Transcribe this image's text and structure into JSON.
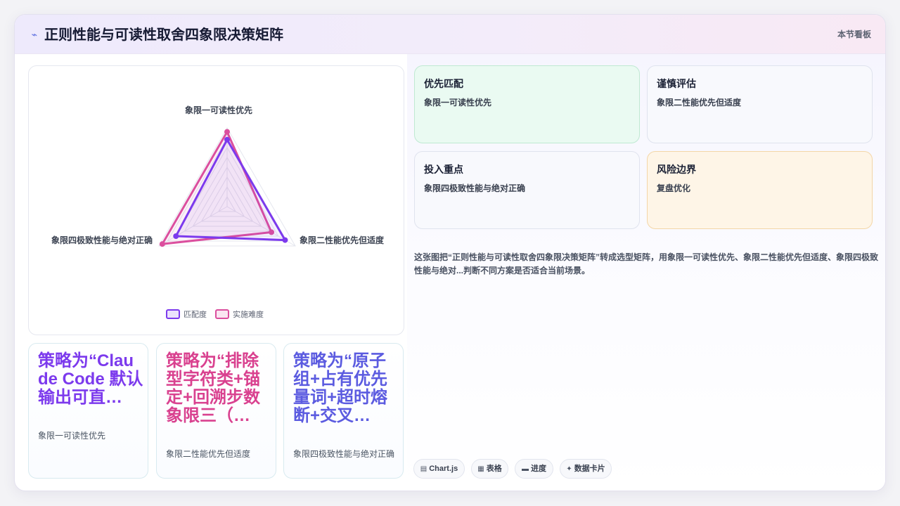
{
  "header": {
    "icon": "sparkline-icon",
    "title": "正则性能与可读性取舍四象限决策矩阵",
    "right_label": "本节看板"
  },
  "chart_data": {
    "type": "radar",
    "axes": [
      "象限一可读性优先",
      "象限二性能优先但适度",
      "象限四极致性能与绝对正确"
    ],
    "rmax": 100,
    "series": [
      {
        "name": "匹配度",
        "values": [
          85,
          85,
          75
        ],
        "color": "#7c3aed"
      },
      {
        "name": "实施难度",
        "values": [
          95,
          65,
          95
        ],
        "color": "#db4f9e"
      }
    ],
    "legend_position": "bottom",
    "grid": true
  },
  "strategies": [
    {
      "title": "策略为“Claude Code 默认输出可直…",
      "subtitle": "象限一可读性优先",
      "color": "#7c3aed"
    },
    {
      "title": "策略为“排除型字符类+锚定+回溯步数象限三（…",
      "subtitle": "象限二性能优先但适度",
      "color": "#d9418f"
    },
    {
      "title": "策略为“原子组+占有优先量词+超时熔断+交叉…",
      "subtitle": "象限四极致性能与绝对正确",
      "color": "#5b5be0"
    }
  ],
  "cards": [
    {
      "title": "优先匹配",
      "subtitle": "象限一可读性优先"
    },
    {
      "title": "谨慎评估",
      "subtitle": "象限二性能优先但适度"
    },
    {
      "title": "投入重点",
      "subtitle": "象限四极致性能与绝对正确"
    },
    {
      "title": "风险边界",
      "subtitle": "复盘优化"
    }
  ],
  "description": "这张图把“正则性能与可读性取舍四象限决策矩阵”转成选型矩阵，用象限一可读性优先、象限二性能优先但适度、象限四极致性能与绝对...判断不同方案是否适合当前场景。",
  "tags": [
    {
      "icon": "chart-icon",
      "glyph": "▤",
      "label": "Chart.js"
    },
    {
      "icon": "table-icon",
      "glyph": "▦",
      "label": "表格"
    },
    {
      "icon": "progress-icon",
      "glyph": "▬",
      "label": "进度"
    },
    {
      "icon": "data-card-icon",
      "glyph": "✦",
      "label": "数据卡片"
    }
  ]
}
